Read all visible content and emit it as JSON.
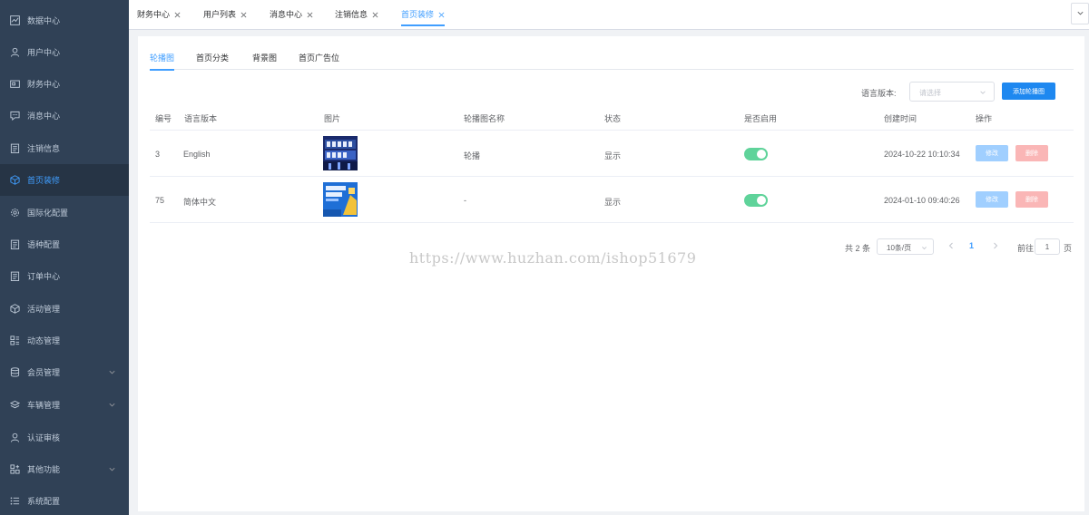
{
  "sidebar": {
    "items": [
      {
        "label": "数据中心",
        "icon": "chart-line-icon"
      },
      {
        "label": "用户中心",
        "icon": "user-icon"
      },
      {
        "label": "财务中心",
        "icon": "wallet-icon"
      },
      {
        "label": "消息中心",
        "icon": "message-icon"
      },
      {
        "label": "注销信息",
        "icon": "clipboard-icon"
      },
      {
        "label": "首页装修",
        "icon": "box-icon",
        "active": true
      },
      {
        "label": "国际化配置",
        "icon": "gear-icon"
      },
      {
        "label": "语种配置",
        "icon": "clipboard-icon"
      },
      {
        "label": "订单中心",
        "icon": "clipboard-icon"
      },
      {
        "label": "活动管理",
        "icon": "box-icon"
      },
      {
        "label": "动态管理",
        "icon": "grid-icon"
      },
      {
        "label": "会员管理",
        "icon": "database-icon",
        "expandable": true
      },
      {
        "label": "车辆管理",
        "icon": "layers-icon",
        "expandable": true
      },
      {
        "label": "认证审核",
        "icon": "user-icon"
      },
      {
        "label": "其他功能",
        "icon": "grid-plus-icon",
        "expandable": true
      },
      {
        "label": "系统配置",
        "icon": "list-icon"
      }
    ]
  },
  "tags": [
    {
      "label": "财务中心"
    },
    {
      "label": "用户列表"
    },
    {
      "label": "消息中心"
    },
    {
      "label": "注销信息"
    },
    {
      "label": "首页装修",
      "active": true
    }
  ],
  "tabs": [
    {
      "label": "轮播图",
      "active": true
    },
    {
      "label": "首页分类"
    },
    {
      "label": "背景图"
    },
    {
      "label": "首页广告位"
    }
  ],
  "filter": {
    "label": "语言版本:",
    "placeholder": "请选择",
    "add_label": "添加轮播图"
  },
  "table": {
    "columns": [
      "编号",
      "语言版本",
      "图片",
      "轮播图名称",
      "状态",
      "是否启用",
      "创建时间",
      "操作"
    ],
    "rows": [
      {
        "id": "3",
        "lang": "English",
        "name": "轮播",
        "status": "显示",
        "enabled": true,
        "created": "2024-10-22 10:10:34",
        "edit": "修改",
        "delete": "删除"
      },
      {
        "id": "75",
        "lang": "简体中文",
        "name": "-",
        "status": "显示",
        "enabled": true,
        "created": "2024-01-10 09:40:26",
        "edit": "修改",
        "delete": "删除"
      }
    ]
  },
  "pagination": {
    "total": "共 2 条",
    "page_size": "10条/页",
    "current_page": "1",
    "goto_label": "前往",
    "goto_value": "1",
    "unit": "页"
  },
  "watermark": "https://www.huzhan.com/ishop51679",
  "colors": {
    "sidebar_bg": "#304156",
    "accent": "#409eff",
    "switch_on": "#5fd39a",
    "primary_button": "#1e88f0"
  }
}
